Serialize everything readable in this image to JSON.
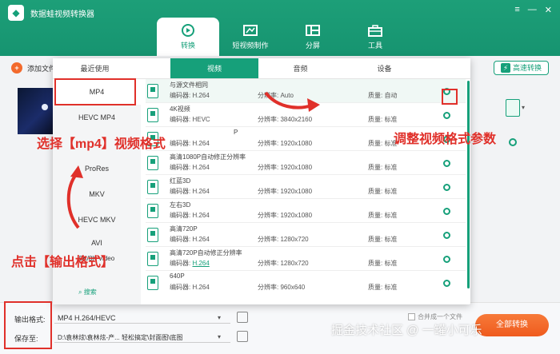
{
  "app": {
    "title": "数据蛙视频转换器"
  },
  "nav": [
    {
      "label": "转换"
    },
    {
      "label": "短视频制作"
    },
    {
      "label": "分屏"
    },
    {
      "label": "工具"
    }
  ],
  "toolbar": {
    "add_file": "添加文件",
    "high_speed": "高速转换"
  },
  "popup": {
    "tabs": [
      "最近使用",
      "视频",
      "音频",
      "设备"
    ],
    "formats": [
      "MP4",
      "HEVC MP4",
      "",
      "ProRes",
      "MKV",
      "HEVC MKV",
      "AVI",
      "5K/8K Video"
    ],
    "search": "搜索",
    "presets": [
      {
        "name": "与源文件相同",
        "codec_label": "编码器:",
        "codec": "H.264",
        "res_label": "分辨率:",
        "res": "Auto",
        "q_label": "质量:",
        "quality": "自动"
      },
      {
        "name": "4K视频",
        "codec_label": "编码器:",
        "codec": "HEVC",
        "res_label": "分辨率:",
        "res": "3840x2160",
        "q_label": "质量:",
        "quality": "标准"
      },
      {
        "name": "P",
        "codec_label": "编码器:",
        "codec": "H.264",
        "res_label": "分辨率:",
        "res": "1920x1080",
        "q_label": "质量:",
        "quality": "标准"
      },
      {
        "name": "高清1080P自动修正分辨率",
        "codec_label": "编码器:",
        "codec": "H.264",
        "res_label": "分辨率:",
        "res": "1920x1080",
        "q_label": "质量:",
        "quality": "标准"
      },
      {
        "name": "红蓝3D",
        "codec_label": "编码器:",
        "codec": "H.264",
        "res_label": "分辨率:",
        "res": "1920x1080",
        "q_label": "质量:",
        "quality": "标准"
      },
      {
        "name": "左右3D",
        "codec_label": "编码器:",
        "codec": "H.264",
        "res_label": "分辨率:",
        "res": "1920x1080",
        "q_label": "质量:",
        "quality": "标准"
      },
      {
        "name": "高清720P",
        "codec_label": "编码器:",
        "codec": "H.264",
        "res_label": "分辨率:",
        "res": "1280x720",
        "q_label": "质量:",
        "quality": "标准"
      },
      {
        "name": "高清720P自动修正分辨率",
        "codec_label": "编码器:",
        "codec": "H.264",
        "res_label": "分辨率:",
        "res": "1280x720",
        "q_label": "质量:",
        "quality": "标准"
      },
      {
        "name": "640P",
        "codec_label": "编码器:",
        "codec": "H.264",
        "res_label": "分辨率:",
        "res": "960x640",
        "q_label": "质量:",
        "quality": "标准"
      }
    ]
  },
  "bottom": {
    "output_label": "输出格式:",
    "output_value": "MP4 H.264/HEVC",
    "save_label": "保存至:",
    "save_value": "D:\\袁林炫\\袁林炫-产... 轻松搞定\\封面图\\底图",
    "merge": "合并成一个文件",
    "start": "全部转换"
  },
  "annotations": {
    "select_mp4": "选择【mp4】视频格式",
    "adjust": "调整视频格式参数",
    "click_output": "点击【输出格式】"
  },
  "watermark": "掘金技术社区 @ 一罐小可乐",
  "colors": {
    "accent": "#16a07a",
    "annotation": "#e0302a",
    "start": "#ef5b1e"
  }
}
